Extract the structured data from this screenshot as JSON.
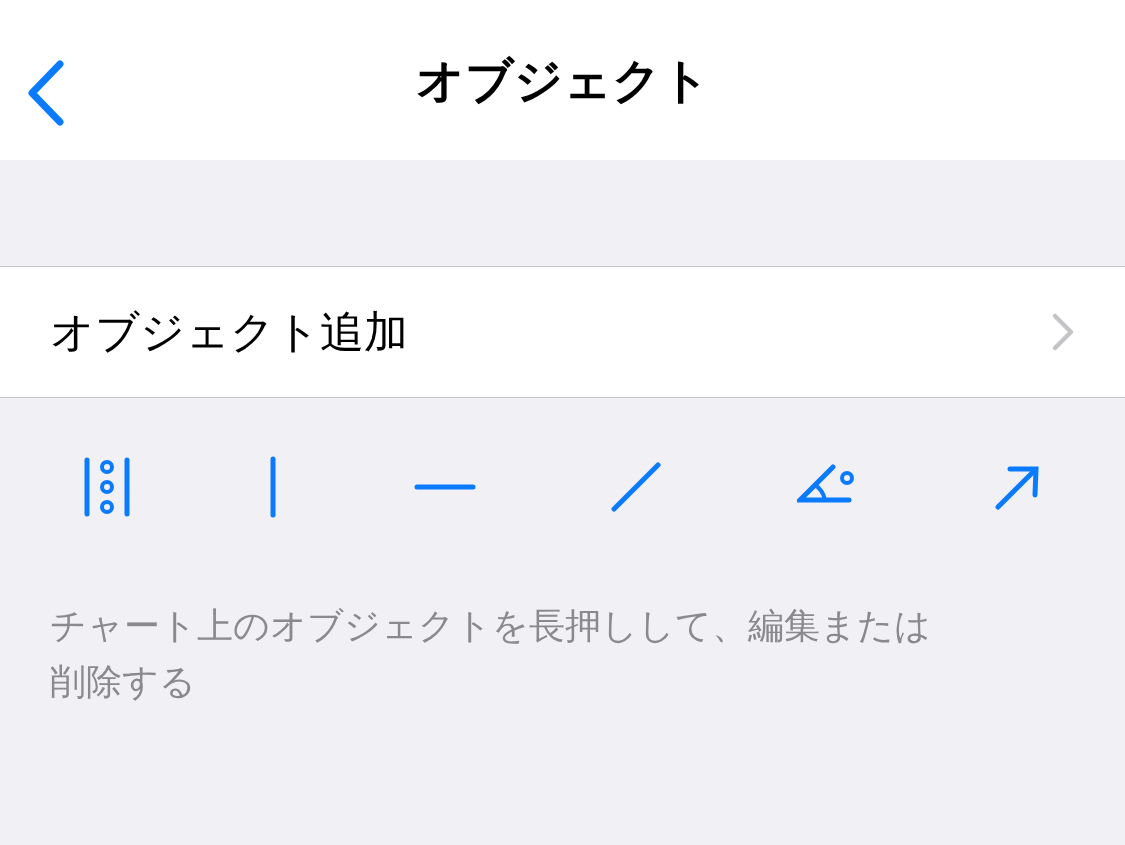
{
  "nav": {
    "title": "オブジェクト"
  },
  "row": {
    "label": "オブジェクト追加"
  },
  "tools": [
    {
      "kind": "channel"
    },
    {
      "kind": "vertical"
    },
    {
      "kind": "horizontal"
    },
    {
      "kind": "trend"
    },
    {
      "kind": "angle"
    },
    {
      "kind": "arrow"
    }
  ],
  "footer": "チャート上のオブジェクトを長押しして、編集または削除する"
}
